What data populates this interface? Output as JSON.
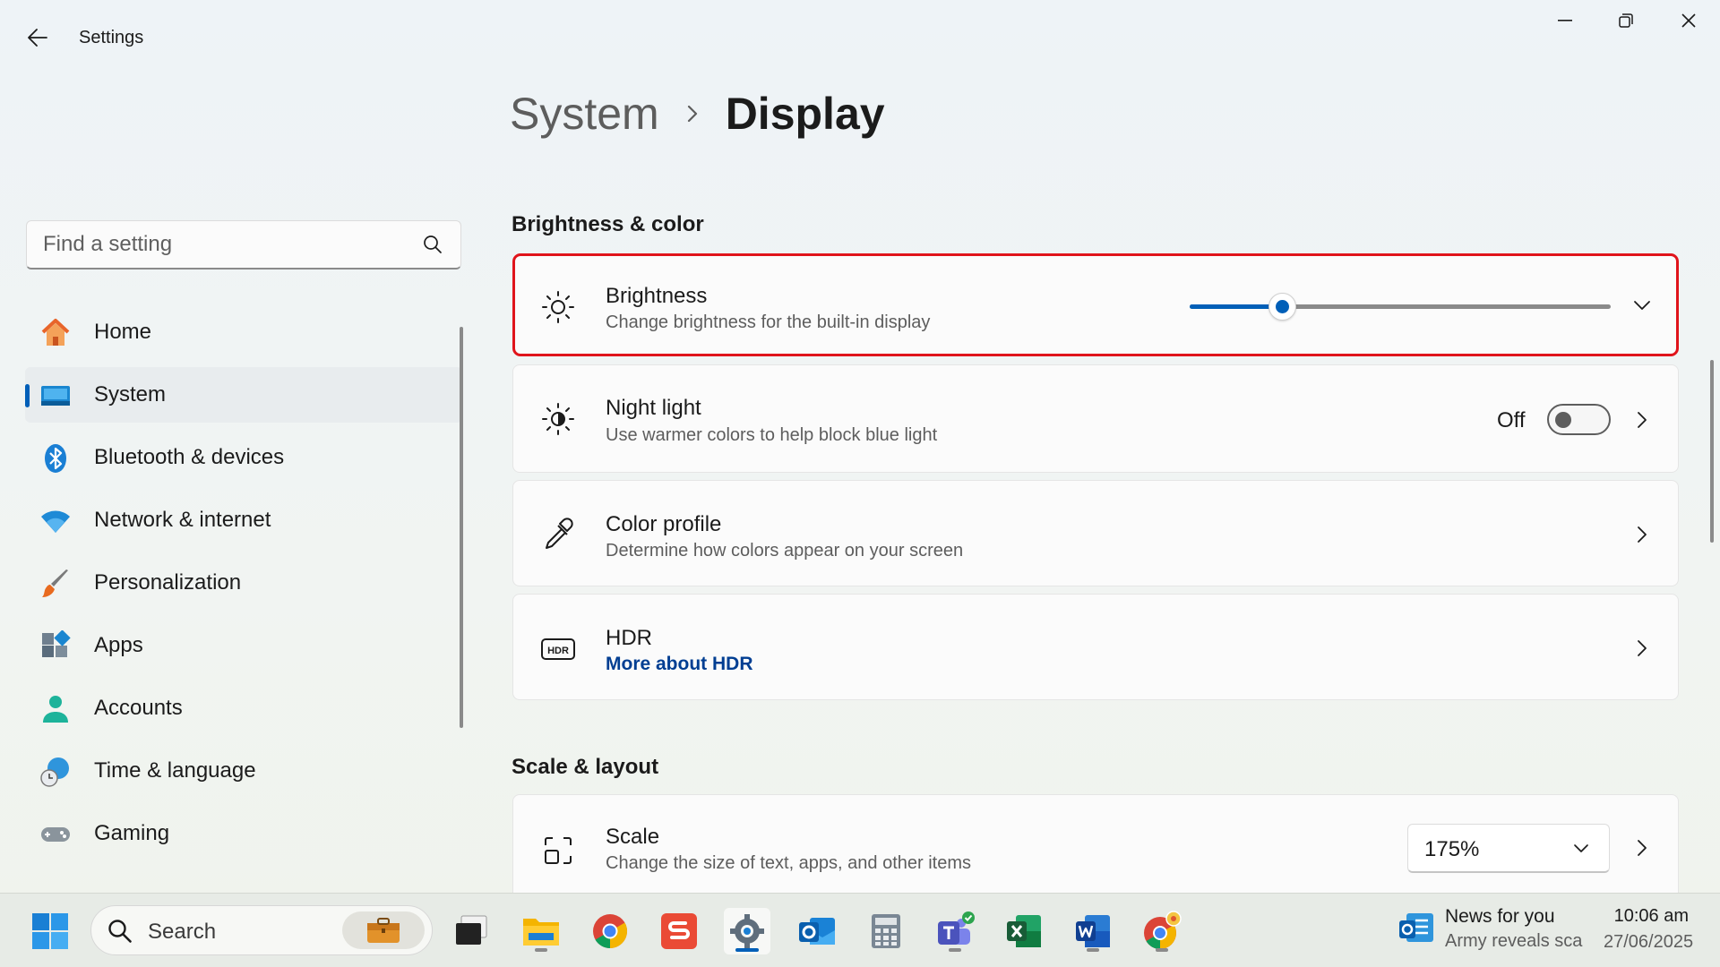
{
  "window": {
    "title": "Settings"
  },
  "search": {
    "placeholder": "Find a setting"
  },
  "nav": {
    "items": [
      {
        "label": "Home",
        "icon": "home-icon"
      },
      {
        "label": "System",
        "icon": "system-icon",
        "active": true
      },
      {
        "label": "Bluetooth & devices",
        "icon": "bluetooth-icon"
      },
      {
        "label": "Network & internet",
        "icon": "wifi-icon"
      },
      {
        "label": "Personalization",
        "icon": "brush-icon"
      },
      {
        "label": "Apps",
        "icon": "apps-icon"
      },
      {
        "label": "Accounts",
        "icon": "person-icon"
      },
      {
        "label": "Time & language",
        "icon": "globe-clock-icon"
      },
      {
        "label": "Gaming",
        "icon": "controller-icon"
      }
    ]
  },
  "breadcrumb": {
    "parent": "System",
    "current": "Display"
  },
  "sections": {
    "brightness_color": "Brightness & color",
    "scale_layout": "Scale & layout"
  },
  "brightness": {
    "title": "Brightness",
    "subtitle": "Change brightness for the built-in display",
    "level": 0.22
  },
  "night_light": {
    "title": "Night light",
    "subtitle": "Use warmer colors to help block blue light",
    "state": "Off"
  },
  "color_profile": {
    "title": "Color profile",
    "subtitle": "Determine how colors appear on your screen"
  },
  "hdr": {
    "title": "HDR",
    "link": "More about HDR"
  },
  "scale": {
    "title": "Scale",
    "subtitle": "Change the size of text, apps, and other items",
    "value": "175%"
  },
  "taskbar": {
    "search_label": "Search",
    "apps": [
      "start-icon",
      "task-view-icon",
      "file-explorer-icon",
      "chrome-icon",
      "wps-icon",
      "settings-icon",
      "outlook-icon",
      "calculator-icon",
      "teams-icon",
      "excel-icon",
      "word-icon",
      "chrome-profile-icon"
    ],
    "news_title": "News for you",
    "news_sub": "Army reveals sca",
    "time": "10:06 am",
    "date": "27/06/2025"
  },
  "colors": {
    "accent": "#005fb8",
    "highlight": "#e0141b"
  }
}
